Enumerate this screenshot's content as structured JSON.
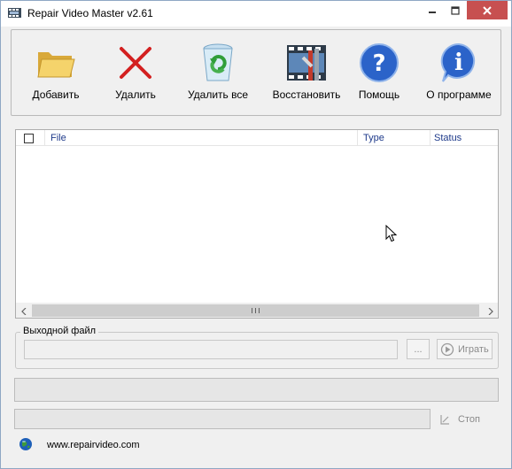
{
  "window": {
    "title": "Repair Video Master v2.61"
  },
  "toolbar": {
    "items": [
      {
        "label": "Добавить",
        "icon": "folder-icon"
      },
      {
        "label": "Удалить",
        "icon": "delete-x-icon"
      },
      {
        "label": "Удалить все",
        "icon": "recycle-bin-icon"
      },
      {
        "label": "Восстановить",
        "icon": "film-tools-icon"
      },
      {
        "label": "Помощь",
        "icon": "help-icon"
      },
      {
        "label": "О программе",
        "icon": "info-icon"
      }
    ]
  },
  "file_list": {
    "columns": [
      "File",
      "Type",
      "Status"
    ],
    "rows": []
  },
  "output": {
    "group_label": "Выходной файл",
    "path_value": "",
    "browse_label": "...",
    "play_label": "Играть"
  },
  "progress": {
    "overall": 0,
    "current": 0,
    "stop_label": "Стоп"
  },
  "footer": {
    "website": "www.repairvideo.com"
  },
  "colors": {
    "close_button": "#c75050",
    "header_text": "#1e3a8a",
    "disabled_text": "#8a8a8a"
  }
}
